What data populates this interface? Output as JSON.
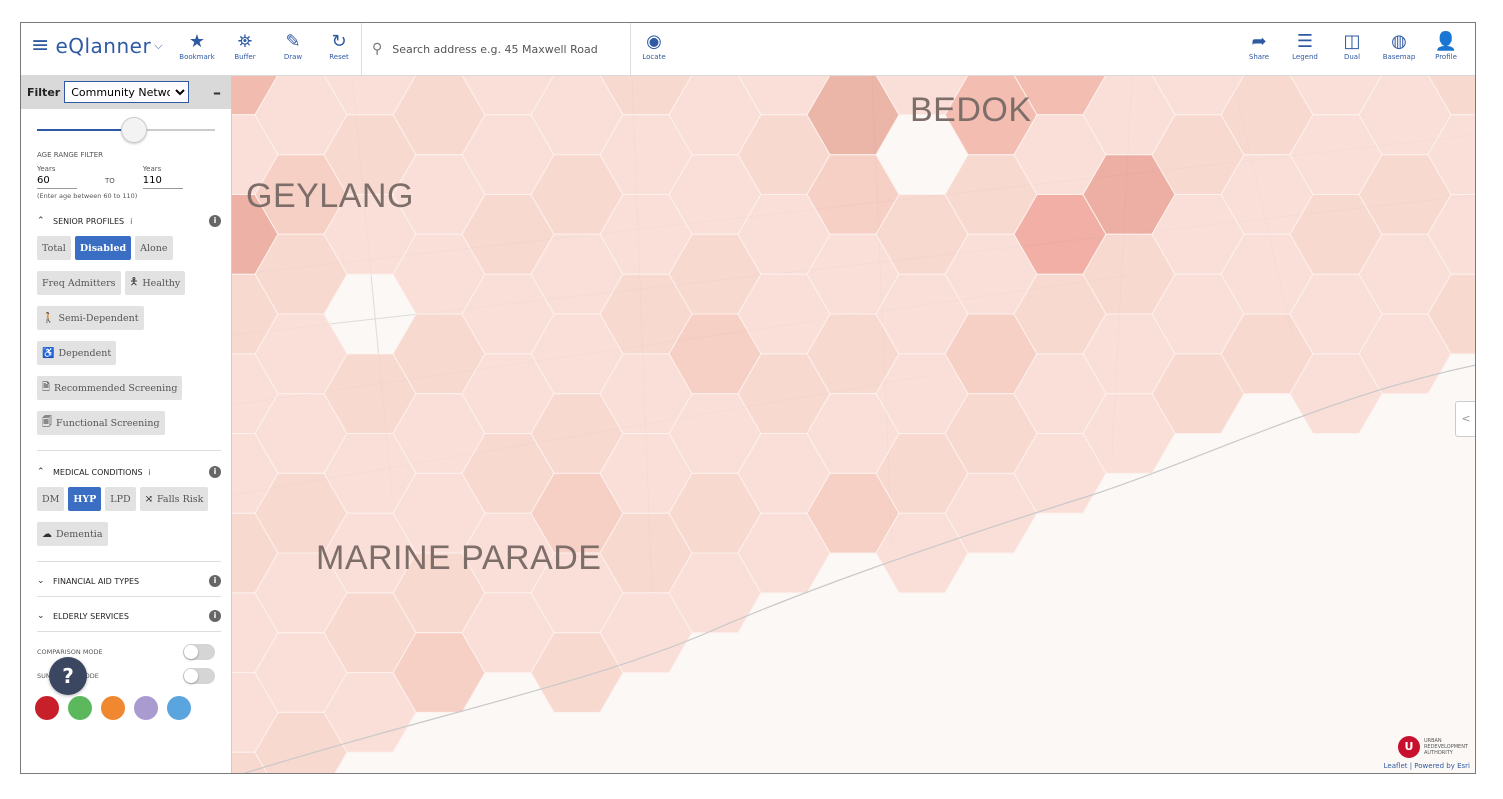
{
  "header": {
    "app_name": "eQlanner",
    "tools_left": [
      {
        "name": "bookmark",
        "label": "Bookmark",
        "glyph": "★"
      },
      {
        "name": "buffer",
        "label": "Buffer",
        "glyph": "⛯"
      },
      {
        "name": "draw",
        "label": "Draw",
        "glyph": "✎"
      },
      {
        "name": "reset",
        "label": "Reset",
        "glyph": "↻"
      }
    ],
    "search_placeholder": "Search address e.g. 45 Maxwell Road",
    "locate": {
      "label": "Locate",
      "glyph": "◉"
    },
    "tools_right": [
      {
        "name": "share",
        "label": "Share",
        "glyph": "➦"
      },
      {
        "name": "legend",
        "label": "Legend",
        "glyph": "☰"
      },
      {
        "name": "dual",
        "label": "Dual",
        "glyph": "◫"
      },
      {
        "name": "basemap",
        "label": "Basemap",
        "glyph": "◍"
      },
      {
        "name": "profile",
        "label": "Profile",
        "glyph": "👤"
      }
    ]
  },
  "sidebar": {
    "filter_label": "Filter",
    "filter_value": "Community Network",
    "age": {
      "title": "AGE RANGE FILTER",
      "from_label": "Years",
      "from_value": "60",
      "to_text": "TO",
      "to_label": "Years",
      "to_value": "110",
      "hint": "(Enter age between 60 to 110)"
    },
    "senior": {
      "title": "SENIOR PROFILES",
      "info_mark": "i",
      "buttons": [
        {
          "label": "Total",
          "active": false,
          "glyph": ""
        },
        {
          "label": "Disabled",
          "active": true,
          "glyph": ""
        },
        {
          "label": "Alone",
          "active": false,
          "glyph": ""
        },
        {
          "label": "Freq Admitters",
          "active": false,
          "glyph": ""
        },
        {
          "label": "Healthy",
          "active": false,
          "glyph": "🯅"
        },
        {
          "label": "Semi-Dependent",
          "active": false,
          "glyph": "🚶"
        },
        {
          "label": "Dependent",
          "active": false,
          "glyph": "♿"
        },
        {
          "label": "Recommended Screening",
          "active": false,
          "glyph": "🗎"
        },
        {
          "label": "Functional Screening",
          "active": false,
          "glyph": "🗐"
        }
      ]
    },
    "medical": {
      "title": "MEDICAL CONDITIONS",
      "info_mark": "i",
      "buttons": [
        {
          "label": "DM",
          "active": false,
          "glyph": ""
        },
        {
          "label": "HYP",
          "active": true,
          "glyph": ""
        },
        {
          "label": "LPD",
          "active": false,
          "glyph": ""
        },
        {
          "label": "Falls Risk",
          "active": false,
          "glyph": "⤨"
        },
        {
          "label": "Dementia",
          "active": false,
          "glyph": "☁"
        }
      ]
    },
    "financial": {
      "title": "FINANCIAL AID TYPES"
    },
    "elderly": {
      "title": "ELDERLY SERVICES"
    },
    "comparison_mode": "COMPARISON MODE",
    "summation_mode": "SUMMATION MODE",
    "swatches": [
      "#c8202a",
      "#5cb85c",
      "#f0882f",
      "#a99bd0",
      "#5aa5dd"
    ],
    "help": "?"
  },
  "map": {
    "labels": [
      "GEYLANG",
      "BEDOK",
      "MARINE PARADE"
    ],
    "collapse": "<",
    "attribution": "Leaflet | Powered by Esri",
    "ura_text": [
      "Urban",
      "Redevelopment",
      "Authority"
    ],
    "ura_mark": "U"
  }
}
